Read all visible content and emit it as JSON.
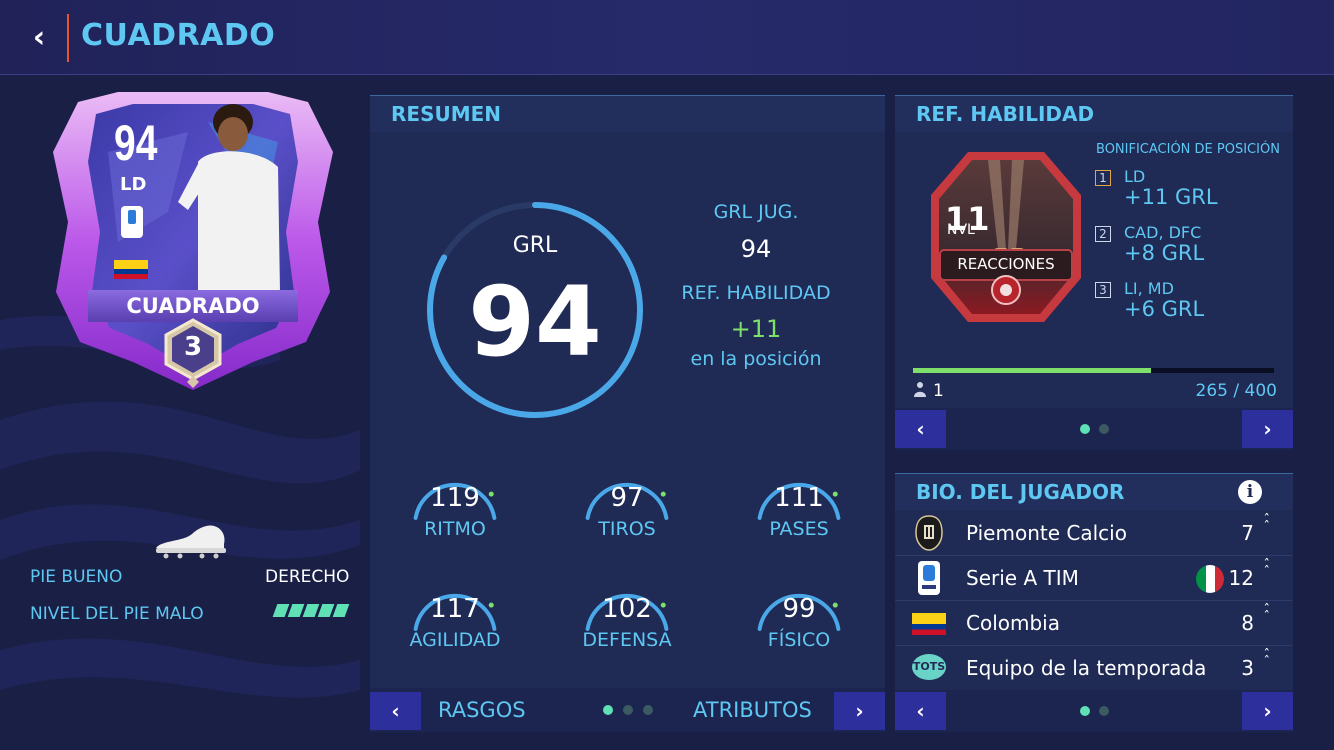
{
  "header": {
    "title": "CUADRADO",
    "back_icon": "chevron-left-icon"
  },
  "card": {
    "rating": "94",
    "position": "LD",
    "name": "CUADRADO",
    "level": "3",
    "league_badge": "SERIE A"
  },
  "player_info": {
    "preferred_foot_label": "PIE BUENO",
    "preferred_foot_value": "DERECHO",
    "weak_foot_label": "NIVEL DEL PIE MALO",
    "weak_foot_stars": 5
  },
  "summary": {
    "title": "RESUMEN",
    "ovr_label": "GRL",
    "ovr_value": "94",
    "player_ovr_label": "GRL JUG.",
    "player_ovr_value": "94",
    "skill_boost_label": "REF. HABILIDAD",
    "skill_boost_value": "+11",
    "skill_boost_sub": "en la posición",
    "stats": [
      {
        "label": "RITMO",
        "value": "119"
      },
      {
        "label": "TIROS",
        "value": "97"
      },
      {
        "label": "PASES",
        "value": "111"
      },
      {
        "label": "AGILIDAD",
        "value": "117"
      },
      {
        "label": "DEFENSA",
        "value": "102"
      },
      {
        "label": "FÍSICO",
        "value": "99"
      }
    ],
    "footer": {
      "left_label": "RASGOS",
      "right_label": "ATRIBUTOS"
    }
  },
  "skill_boost": {
    "title": "REF. HABILIDAD",
    "bonus_title": "BONIFICACIÓN DE POSICIÓN",
    "badge_level": "11",
    "badge_level_label": "NVL",
    "badge_name": "REACCIONES",
    "positions": [
      {
        "rank": "1",
        "pos": "LD",
        "bonus": "+11 GRL"
      },
      {
        "rank": "2",
        "pos": "CAD, DFC",
        "bonus": "+8 GRL"
      },
      {
        "rank": "3",
        "pos": "LI, MD",
        "bonus": "+6 GRL"
      }
    ],
    "progress_fraction": 0.66,
    "count": "1",
    "progress_current": "265",
    "progress_total": "/ 400"
  },
  "bio": {
    "title": "BIO. DEL JUGADOR",
    "rows": [
      {
        "name": "Piemonte Calcio",
        "value": "7"
      },
      {
        "name": "Serie A TIM",
        "value": "12"
      },
      {
        "name": "Colombia",
        "value": "8"
      },
      {
        "name": "Equipo de la temporada",
        "value": "3"
      }
    ],
    "tots_text": "TOTS"
  },
  "colors": {
    "accent": "#5ec8f2",
    "green": "#5fe0b5",
    "button": "#2d2f9c",
    "orange": "#e2572b"
  }
}
